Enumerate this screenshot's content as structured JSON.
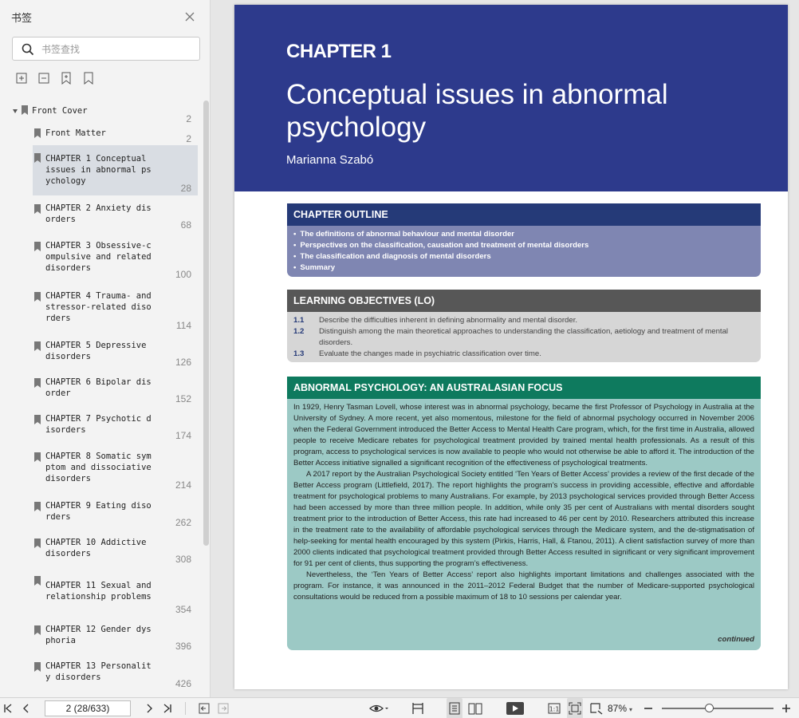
{
  "sidebar": {
    "title": "书签",
    "search_placeholder": "书签查找",
    "bookmarks": [
      {
        "label": "Front Cover",
        "page": "2"
      },
      {
        "label": "Front Matter",
        "page": "2"
      },
      {
        "label": "CHAPTER 1 Conceptual\nissues in abnormal ps\nychology",
        "page": "28"
      },
      {
        "label": "CHAPTER 2 Anxiety dis\norders",
        "page": "68"
      },
      {
        "label": "CHAPTER 3 Obsessive-c\nompulsive and related\ndisorders",
        "page": "100"
      },
      {
        "label": "CHAPTER 4 Trauma- and\nstressor-related diso\nrders",
        "page": "114"
      },
      {
        "label": "CHAPTER 5 Depressive\ndisorders",
        "page": "126"
      },
      {
        "label": "CHAPTER 6 Bipolar dis\norder",
        "page": "152"
      },
      {
        "label": "CHAPTER 7 Psychotic d\nisorders",
        "page": "174"
      },
      {
        "label": "CHAPTER 8 Somatic sym\nptom and dissociative\ndisorders",
        "page": "214"
      },
      {
        "label": "CHAPTER 9 Eating diso\nrders",
        "page": "262"
      },
      {
        "label": "CHAPTER 10 Addictive\ndisorders",
        "page": "308"
      },
      {
        "label": "CHAPTER 11 Sexual and\nrelationship problems",
        "page": "354"
      },
      {
        "label": "CHAPTER 12 Gender dys\nphoria",
        "page": "396"
      },
      {
        "label": "CHAPTER 13 Personalit\ny disorders",
        "page": "426"
      }
    ]
  },
  "document": {
    "chapter_number": "CHAPTER 1",
    "title": "Conceptual issues in abnormal psychology",
    "author": "Marianna Szabó",
    "outline": {
      "heading": "CHAPTER OUTLINE",
      "items": [
        "The definitions of abnormal behaviour and mental disorder",
        "Perspectives on the classification, causation and treatment of mental disorders",
        "The classification and diagnosis of mental disorders",
        "Summary"
      ]
    },
    "objectives": {
      "heading": "LEARNING OBJECTIVES (LO)",
      "items": [
        {
          "num": "1.1",
          "text": "Describe the difficulties inherent in defining abnormality and mental disorder."
        },
        {
          "num": "1.2",
          "text": "Distinguish among the main theoretical approaches to understanding the classification, aetiology and treatment of mental disorders."
        },
        {
          "num": "1.3",
          "text": "Evaluate the changes made in psychiatric classification over time."
        }
      ]
    },
    "focus": {
      "heading": "ABNORMAL PSYCHOLOGY: AN AUSTRALASIAN FOCUS",
      "paragraphs": [
        "In 1929, Henry Tasman Lovell, whose interest was in abnormal psychology, became the first Professor of Psychology in Australia at the University of Sydney. A more recent, yet also momentous, milestone for the field of abnormal psychology occurred in November 2006 when the Federal Government introduced the Better Access to Mental Health Care program, which, for the first time in Australia, allowed people to receive Medicare rebates for psychological treatment provided by trained mental health professionals. As a result of this program, access to psychological services is now available to people who would not otherwise be able to afford it. The introduction of the Better Access initiative signalled a significant recognition of the effectiveness of psychological treatments.",
        "A 2017 report by the Australian Psychological Society entitled ‘Ten Years of Better Access’ provides a review of the first decade of the Better Access program (Littlefield, 2017). The report highlights the program’s success in providing accessible, effective and affordable treatment for psychological problems to many Australians. For example, by 2013 psychological services provided through Better Access had been accessed by more than three million people. In addition, while only 35 per cent of Australians with mental disorders sought treatment prior to the introduction of Better Access, this rate had increased to 46 per cent by 2010. Researchers attributed this increase in the treatment rate to the availability of affordable psychological services through the Medicare system, and the de-stigmatisation of help-seeking for mental health encouraged by this system (Pirkis, Harris, Hall, & Ftanou, 2011). A client satisfaction survey of more than 2000 clients indicated that psychological treatment provided through Better Access resulted in significant or very significant improvement for 91 per cent of clients, thus supporting the program’s effectiveness.",
        "Nevertheless, the ‘Ten Years of Better Access’ report also highlights important limitations and challenges associated with the program. For instance, it was announced in the 2011–2012 Federal Budget that the number of Medicare-supported psychological consultations would be reduced from a possible maximum of 18 to 10 sessions per calendar year."
      ],
      "continued": "continued"
    }
  },
  "toolbar": {
    "page_indicator": "2 (28/633)",
    "zoom": "87%",
    "zoom_level_percent": 87
  },
  "colors": {
    "header_blue": "#2d3a8c",
    "outline_header": "#253a78",
    "outline_body": "#7f86b2",
    "lo_header": "#575757",
    "lo_body": "#d6d6d6",
    "focus_header": "#0e7a5e",
    "focus_body": "#9cc9c5"
  }
}
